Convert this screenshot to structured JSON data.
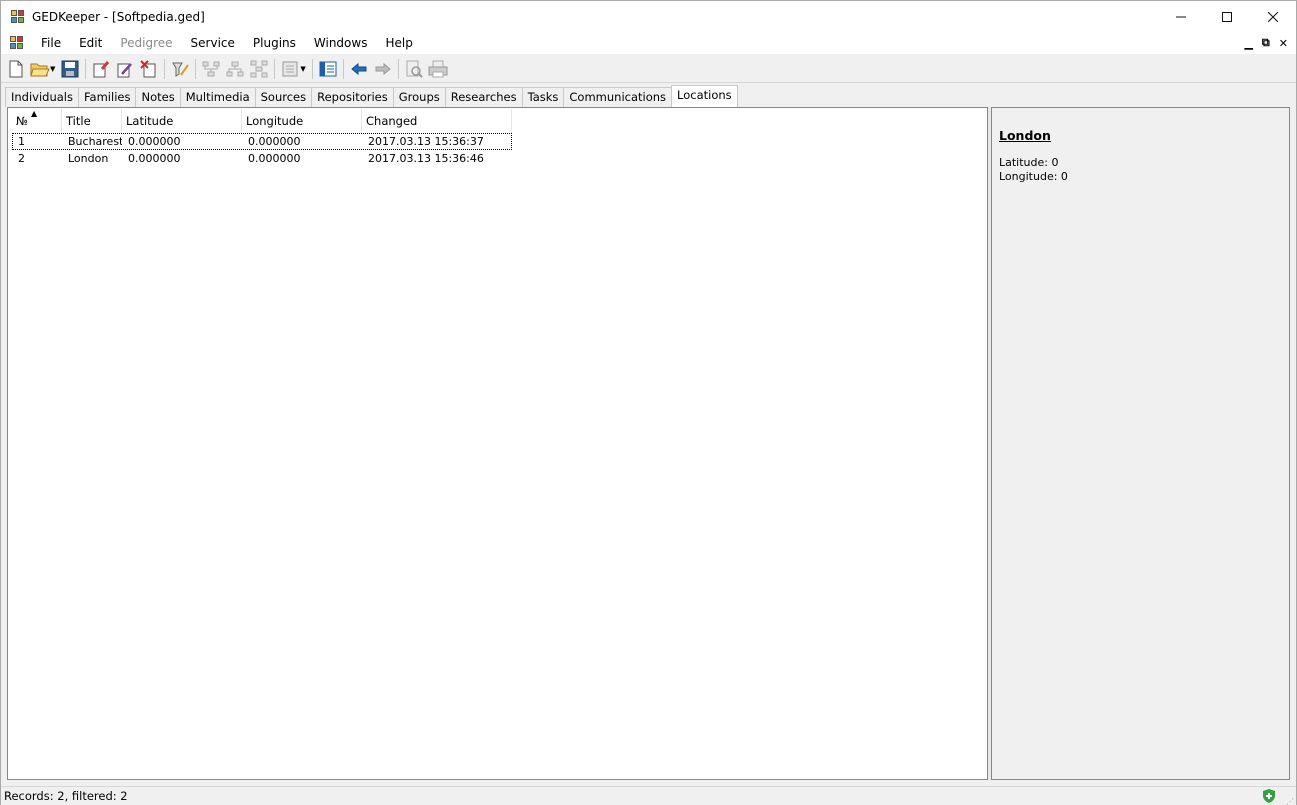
{
  "window": {
    "title": "GEDKeeper - [Softpedia.ged]"
  },
  "menu": [
    "File",
    "Edit",
    "Pedigree",
    "Service",
    "Plugins",
    "Windows",
    "Help"
  ],
  "menu_disabled": [
    "Pedigree"
  ],
  "toolbar_icons": [
    "new-file-icon",
    "open-file-icon",
    "save-icon",
    "add-record-icon",
    "edit-record-icon",
    "delete-record-icon",
    "filter-icon",
    "tree-ancestors-icon",
    "tree-descendants-icon",
    "tree-both-icon",
    "pedigree-icon",
    "summary-view-icon",
    "back-arrow-icon",
    "forward-arrow-icon",
    "print-preview-icon",
    "print-icon"
  ],
  "tabs": [
    "Individuals",
    "Families",
    "Notes",
    "Multimedia",
    "Sources",
    "Repositories",
    "Groups",
    "Researches",
    "Tasks",
    "Communications",
    "Locations"
  ],
  "active_tab": "Locations",
  "table": {
    "columns": [
      "№",
      "Title",
      "Latitude",
      "Longitude",
      "Changed"
    ],
    "rows": [
      {
        "no": "1",
        "title": "Bucharest",
        "lat": "0.000000",
        "lon": "0.000000",
        "changed": "2017.03.13 15:36:37"
      },
      {
        "no": "2",
        "title": "London",
        "lat": "0.000000",
        "lon": "0.000000",
        "changed": "2017.03.13 15:36:46"
      }
    ]
  },
  "summary": {
    "title": "London",
    "latitude": "Latitude: 0",
    "longitude": "Longitude: 0"
  },
  "status": {
    "text": "Records: 2, filtered: 2"
  },
  "colors": {
    "accent_blue": "#1a5fb4",
    "selection_outline": "#000000",
    "status_shield": "#2fa33b"
  }
}
